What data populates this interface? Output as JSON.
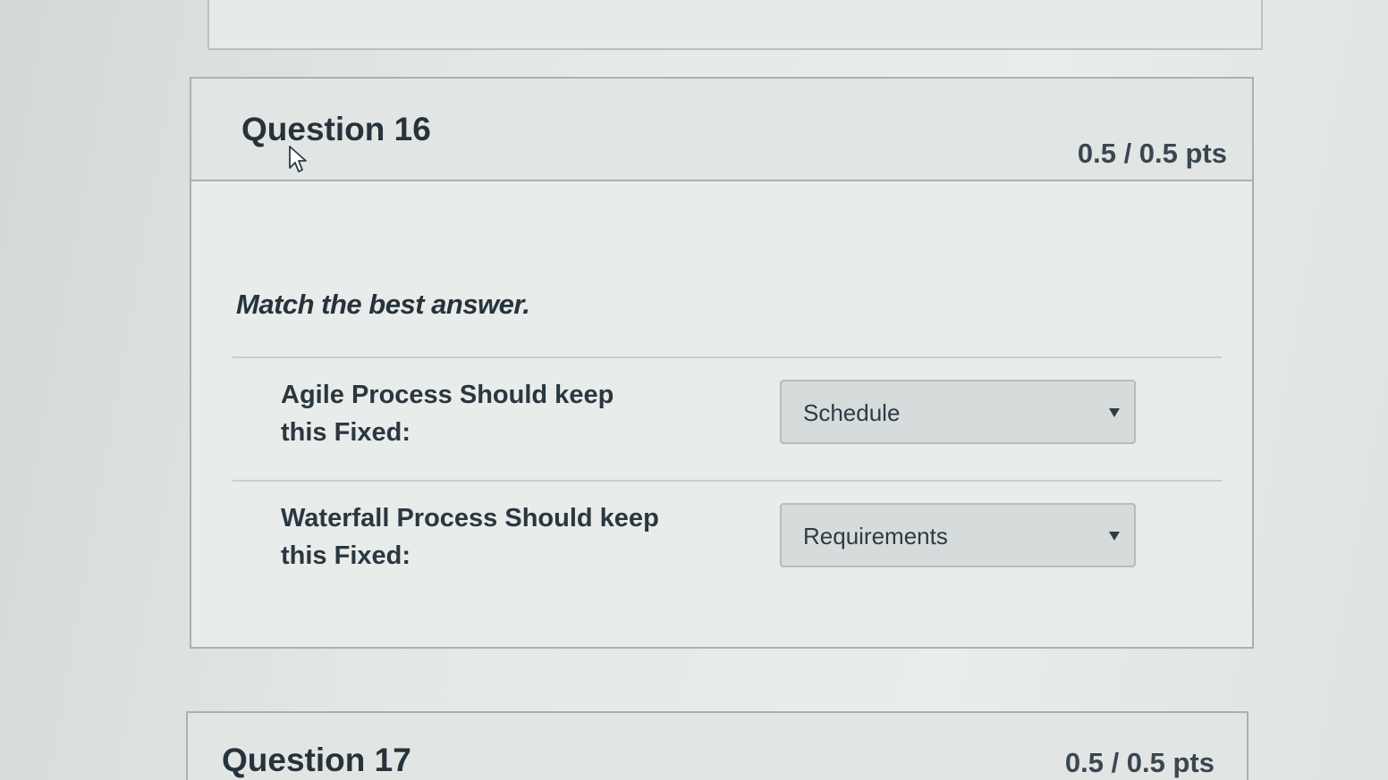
{
  "questions": [
    {
      "title": "Question 16",
      "points": "0.5 / 0.5 pts",
      "prompt": "Match the best answer.",
      "matches": [
        {
          "label": "Agile Process Should keep this Fixed:",
          "selected": "Schedule"
        },
        {
          "label": "Waterfall Process Should keep this Fixed:",
          "selected": "Requirements"
        }
      ]
    },
    {
      "title": "Question 17",
      "points": "0.5 / 0.5 pts"
    }
  ],
  "icons": {
    "cursor": "mouse-pointer-icon",
    "dropdown": "caret-down-icon"
  }
}
